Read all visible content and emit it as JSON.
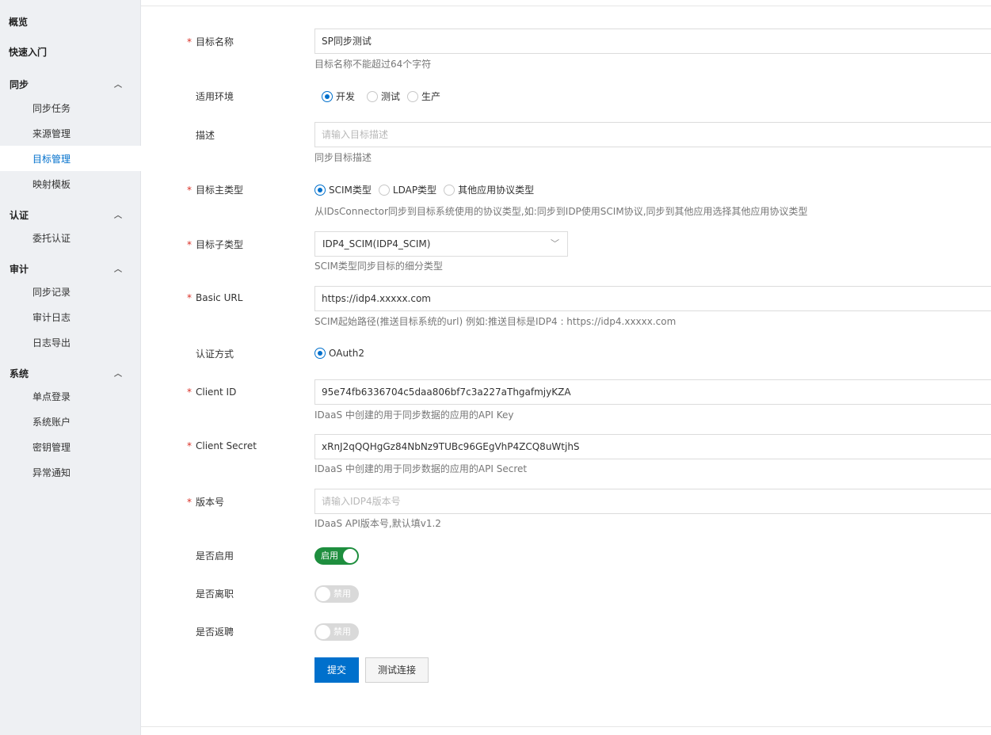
{
  "sidebar": {
    "overview": "概览",
    "quickstart": "快速入门",
    "groups": [
      {
        "title": "同步",
        "items": [
          "同步任务",
          "来源管理",
          "目标管理",
          "映射模板"
        ]
      },
      {
        "title": "认证",
        "items": [
          "委托认证"
        ]
      },
      {
        "title": "审计",
        "items": [
          "同步记录",
          "审计日志",
          "日志导出"
        ]
      },
      {
        "title": "系统",
        "items": [
          "单点登录",
          "系统账户",
          "密钥管理",
          "异常通知"
        ]
      }
    ],
    "active_item": "目标管理",
    "chevron": "chevron-up-icon"
  },
  "form": {
    "target_name": {
      "label": "目标名称",
      "required": true,
      "value": "SP同步测试",
      "help": "目标名称不能超过64个字符"
    },
    "environment": {
      "label": "适用环境",
      "options": [
        "开发",
        "测试",
        "生产"
      ],
      "selected": "开发"
    },
    "description": {
      "label": "描述",
      "placeholder": "请输入目标描述",
      "help": "同步目标描述"
    },
    "main_type": {
      "label": "目标主类型",
      "required": true,
      "options": [
        "SCIM类型",
        "LDAP类型",
        "其他应用协议类型"
      ],
      "selected": "SCIM类型",
      "help": "从IDsConnector同步到目标系统使用的协议类型,如:同步到IDP使用SCIM协议,同步到其他应用选择其他应用协议类型"
    },
    "sub_type": {
      "label": "目标子类型",
      "required": true,
      "value": "IDP4_SCIM(IDP4_SCIM)",
      "help": "SCIM类型同步目标的细分类型"
    },
    "basic_url": {
      "label": "Basic URL",
      "required": true,
      "value": "https://idp4.xxxxx.com",
      "help": "SCIM起始路径(推送目标系统的url) 例如:推送目标是IDP4 : https://idp4.xxxxx.com"
    },
    "auth_method": {
      "label": "认证方式",
      "options": [
        "OAuth2"
      ],
      "selected": "OAuth2"
    },
    "client_id": {
      "label": "Client ID",
      "required": true,
      "value": "95e74fb6336704c5daa806bf7c3a227aThgafmjyKZA",
      "help": "IDaaS 中创建的用于同步数据的应用的API Key"
    },
    "client_secret": {
      "label": "Client Secret",
      "required": true,
      "value": "xRnJ2qQQHgGz84NbNz9TUBc96GEgVhP4ZCQ8uWtjhS",
      "help": "IDaaS 中创建的用于同步数据的应用的API Secret"
    },
    "version": {
      "label": "版本号",
      "required": true,
      "placeholder": "请输入IDP4版本号",
      "help": "IDaaS API版本号,默认填v1.2"
    },
    "enabled": {
      "label": "是否启用",
      "state": "启用",
      "on": true
    },
    "resigned": {
      "label": "是否离职",
      "state": "禁用",
      "on": false
    },
    "rehired": {
      "label": "是否返聘",
      "state": "禁用",
      "on": false
    },
    "submit_label": "提交",
    "test_label": "测试连接"
  },
  "colors": {
    "accent": "#0070cc",
    "toggle_on": "#1e8e3e",
    "required": "#d93026"
  }
}
